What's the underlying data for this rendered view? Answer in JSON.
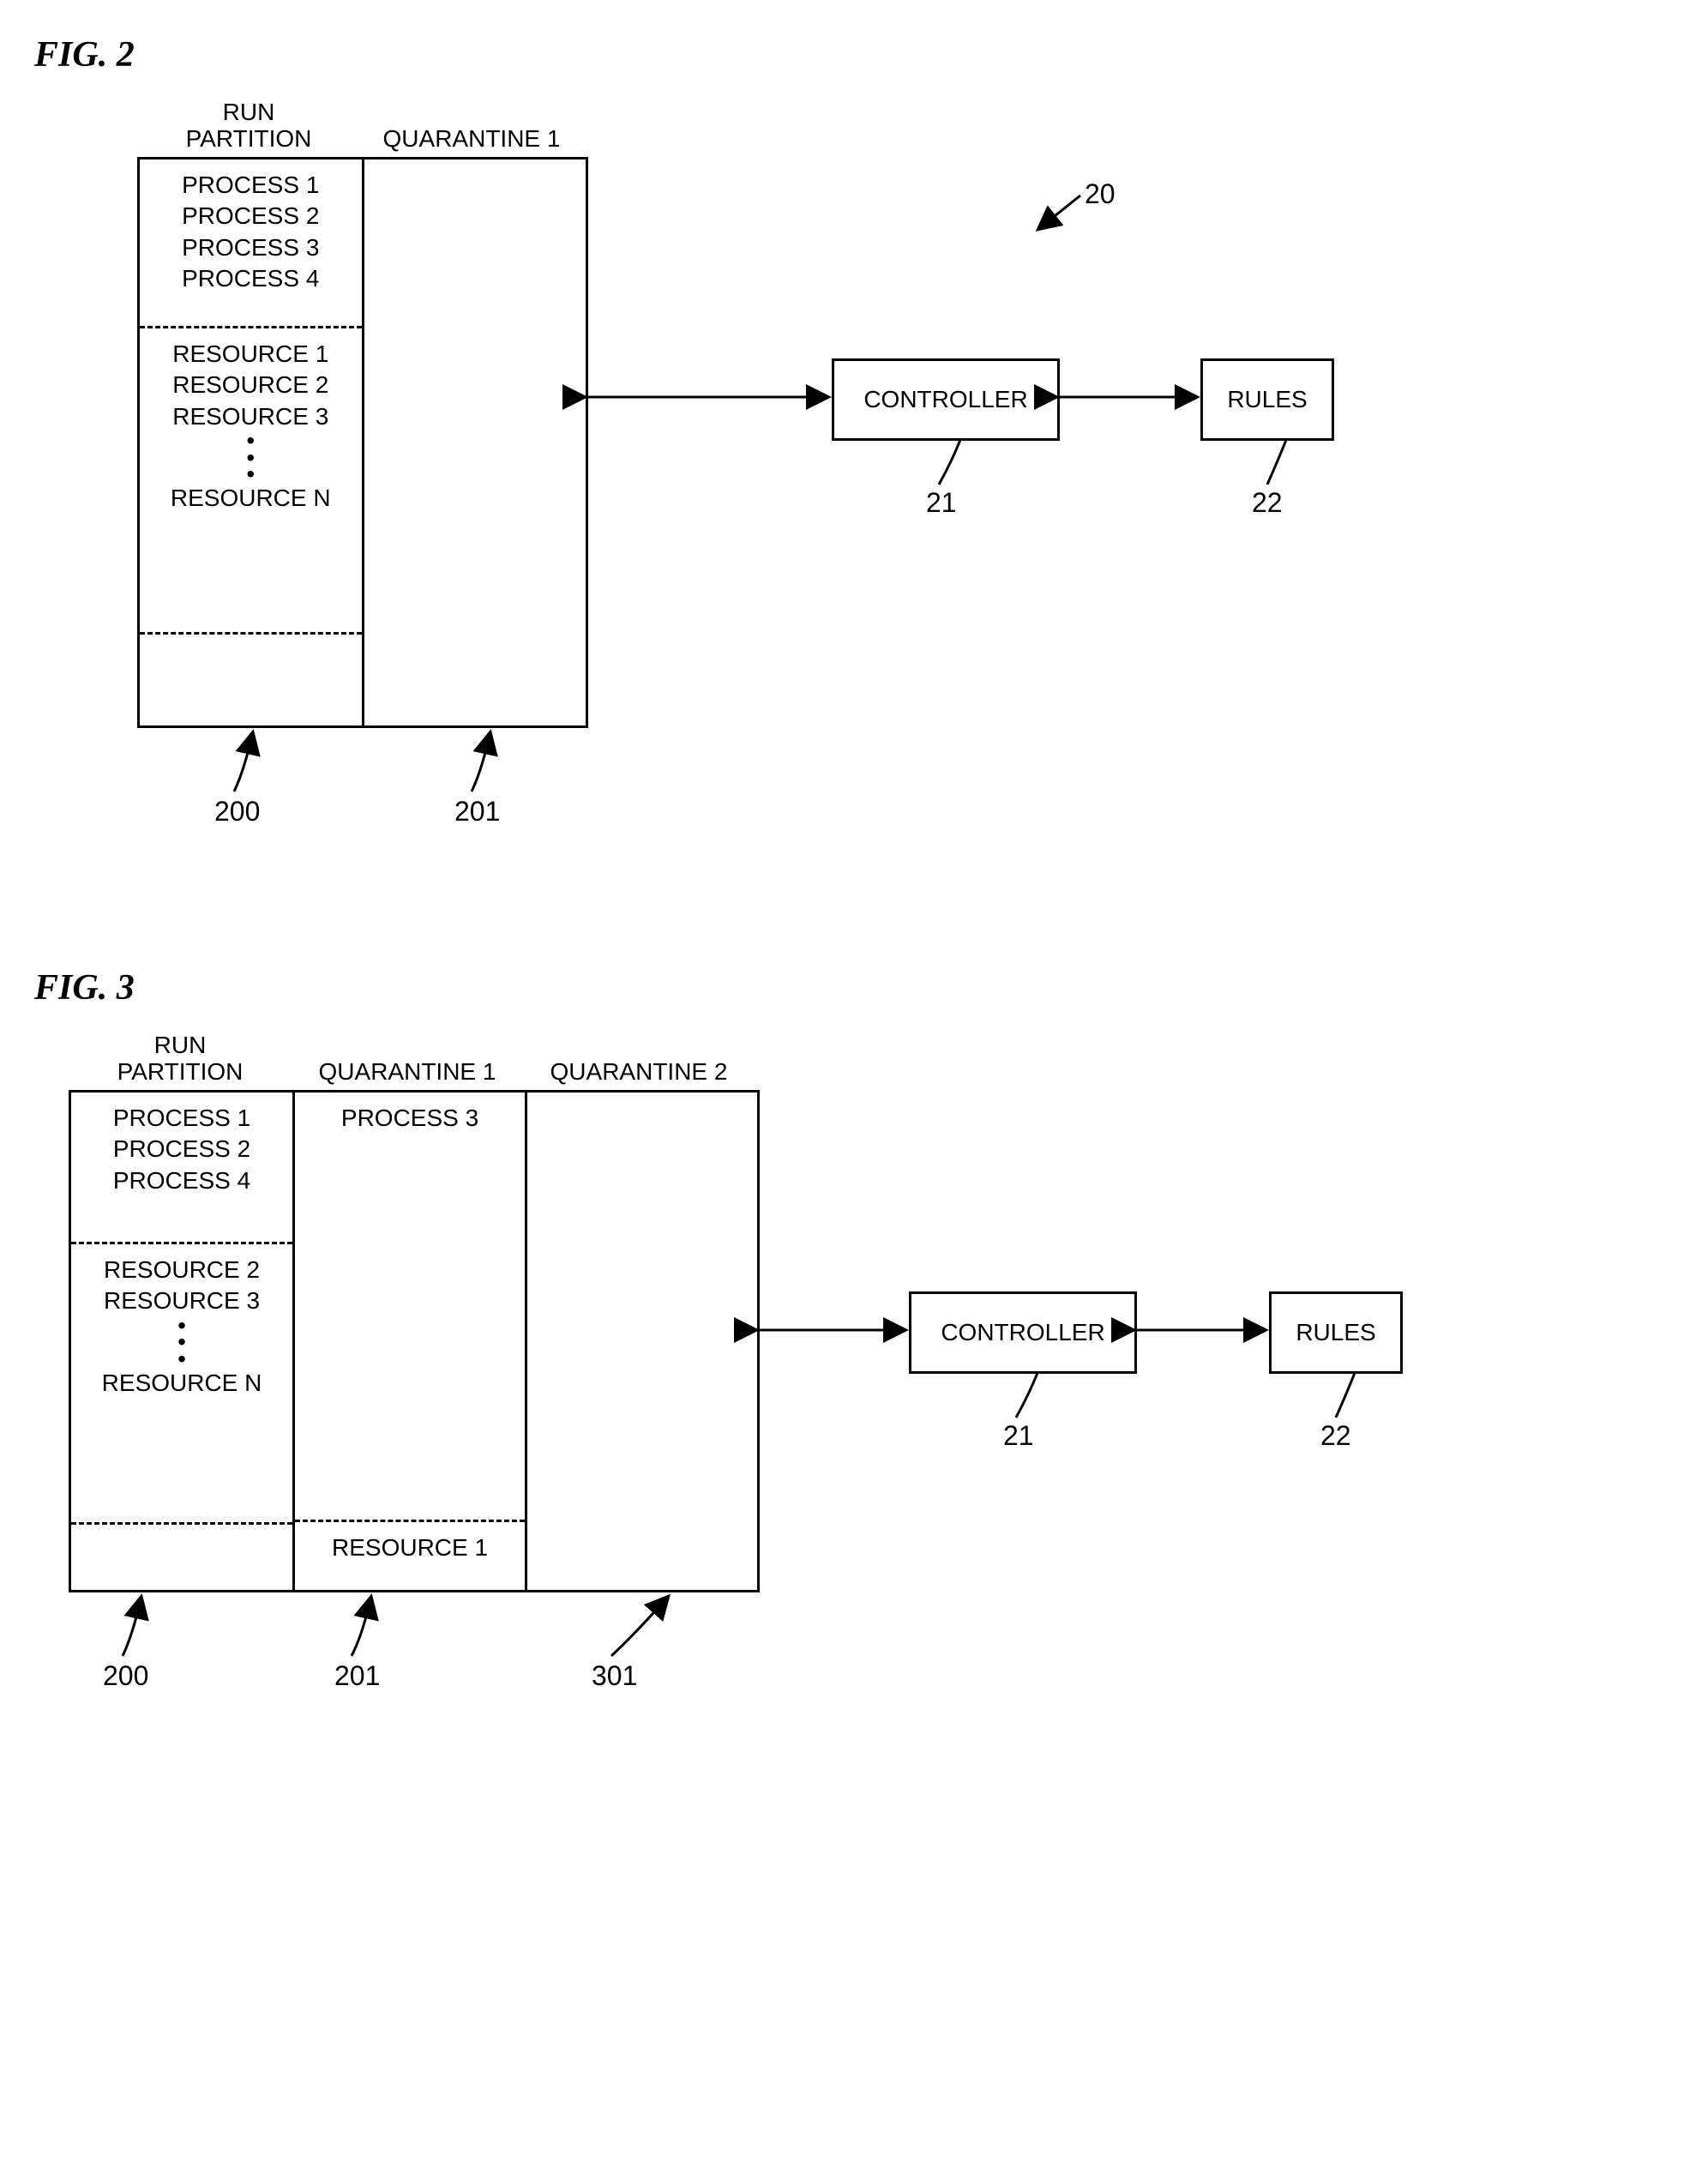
{
  "fig2": {
    "title": "FIG. 2",
    "headers": {
      "run": "RUN\nPARTITION",
      "q1": "QUARANTINE 1"
    },
    "run_processes": [
      "PROCESS 1",
      "PROCESS 2",
      "PROCESS 3",
      "PROCESS 4"
    ],
    "run_resources_top": [
      "RESOURCE 1",
      "RESOURCE 2",
      "RESOURCE 3"
    ],
    "run_resources_bottom": "RESOURCE N",
    "controller": "CONTROLLER",
    "rules": "RULES",
    "refs": {
      "r20": "20",
      "r21": "21",
      "r22": "22",
      "r200": "200",
      "r201": "201"
    }
  },
  "fig3": {
    "title": "FIG. 3",
    "headers": {
      "run": "RUN\nPARTITION",
      "q1": "QUARANTINE 1",
      "q2": "QUARANTINE 2"
    },
    "run_processes": [
      "PROCESS 1",
      "PROCESS 2",
      "PROCESS 4"
    ],
    "q1_processes": [
      "PROCESS 3"
    ],
    "run_resources_top": [
      "RESOURCE 2",
      "RESOURCE 3"
    ],
    "run_resources_bottom": "RESOURCE N",
    "q1_resource": "RESOURCE 1",
    "controller": "CONTROLLER",
    "rules": "RULES",
    "refs": {
      "r21": "21",
      "r22": "22",
      "r200": "200",
      "r201": "201",
      "r301": "301"
    }
  }
}
